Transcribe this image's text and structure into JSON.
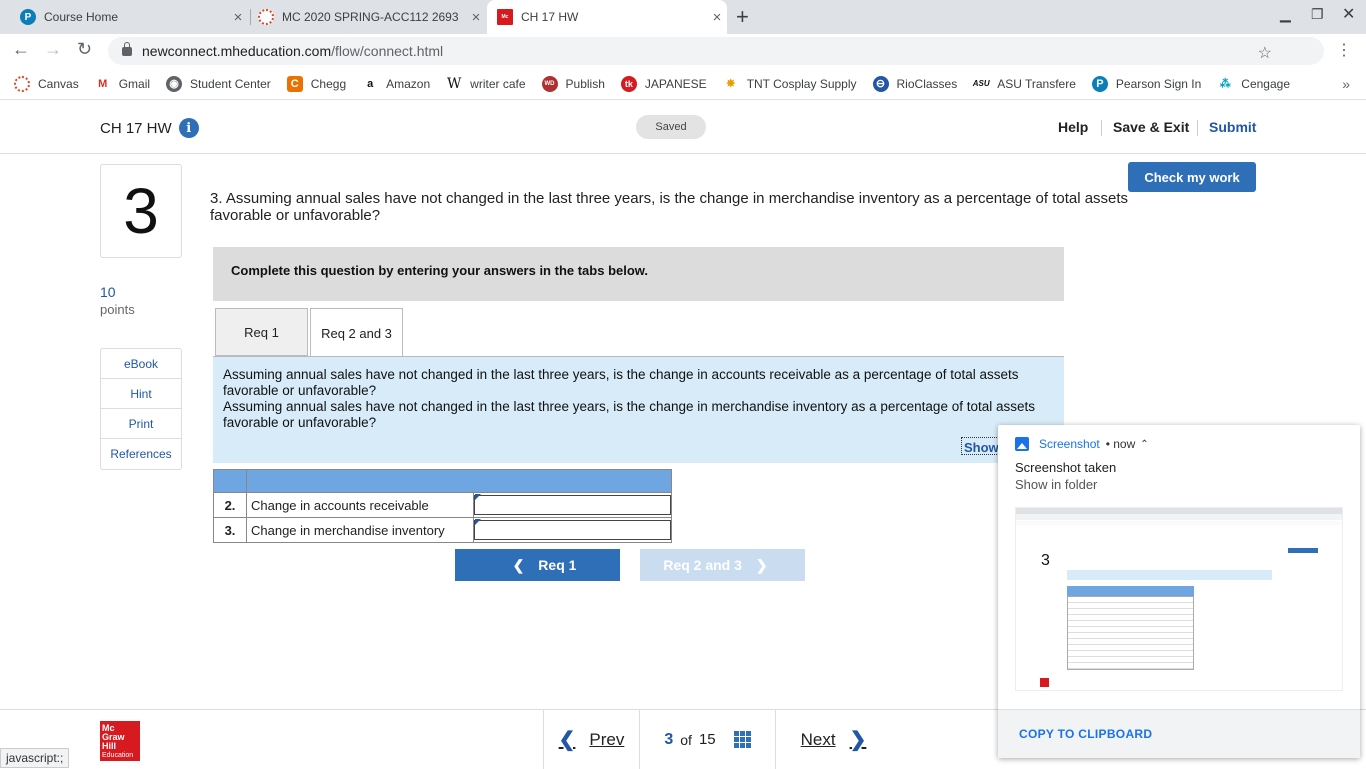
{
  "browser": {
    "tabs": [
      {
        "title": "Course Home",
        "icon": "pearson-icon"
      },
      {
        "title": "MC 2020 SPRING-ACC112 2693",
        "icon": "canvas-icon"
      },
      {
        "title": "CH 17 HW",
        "icon": "mcgraw-hill-icon"
      }
    ],
    "close_glyph": "×",
    "new_tab": "+",
    "url_host": "newconnect.mheducation.com",
    "url_path": "/flow/connect.html",
    "bookmarks": [
      "Canvas",
      "Gmail",
      "Student Center",
      "Chegg",
      "Amazon",
      "writer cafe",
      "Publish",
      "JAPANESE",
      "TNT Cosplay Supply",
      "RioClasses",
      "ASU Transfere",
      "Pearson Sign In",
      "Cengage"
    ],
    "bookmarks_more": "»",
    "status_text": "javascript:;"
  },
  "header": {
    "title": "CH 17 HW",
    "info": "i",
    "saved": "Saved",
    "help": "Help",
    "save_exit": "Save & Exit",
    "submit": "Submit"
  },
  "question": {
    "number": "3",
    "points": "10",
    "points_label": "points",
    "side_links": [
      "eBook",
      "Hint",
      "Print",
      "References"
    ],
    "check_my_work": "Check my work",
    "text": "3. Assuming annual sales have not changed in the last three years, is the change in merchandise inventory as a percentage of total assets favorable or unfavorable?",
    "instructions": "Complete this question by entering your answers in the tabs below.",
    "tabs": [
      "Req 1",
      "Req 2 and 3"
    ],
    "prompt_1": "Assuming annual sales have not changed in the last three years, is the change in accounts receivable as a percentage of total assets favorable or unfavorable?",
    "prompt_2": "Assuming annual sales have not changed in the last three years, is the change in merchandise inventory as a percentage of total assets favorable or unfavorable?",
    "show_link": "Show",
    "rows": [
      {
        "num": "2.",
        "label": "Change in accounts receivable",
        "value": ""
      },
      {
        "num": "3.",
        "label": "Change in merchandise inventory",
        "value": ""
      }
    ],
    "prev_req": "Req 1",
    "next_req": "Req 2 and 3"
  },
  "footer": {
    "logo": [
      "Mc",
      "Graw",
      "Hill",
      "Education"
    ],
    "prev": "Prev",
    "current": "3",
    "of": "of",
    "total": "15",
    "next": "Next"
  },
  "notification": {
    "app": "Screenshot",
    "time": "• now",
    "title": "Screenshot taken",
    "subtitle": "Show in folder",
    "action": "COPY TO CLIPBOARD"
  }
}
